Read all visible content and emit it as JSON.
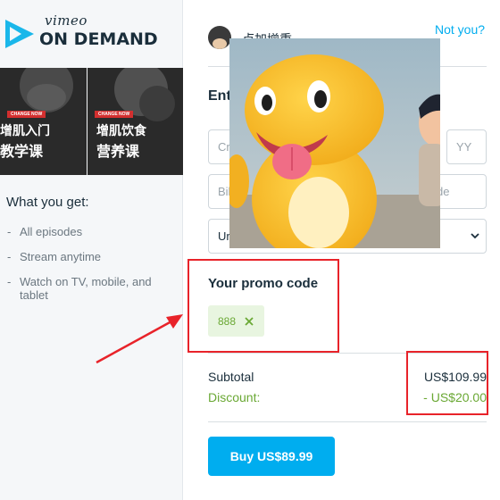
{
  "brand": {
    "logo_top": "vimeo",
    "logo_bottom": "ON DEMAND",
    "mark_color": "#1ab7ea"
  },
  "thumbnails": [
    {
      "badge": "CHANGE NOW",
      "title_line1": "增肌入门",
      "title_line2": "教学课"
    },
    {
      "badge": "CHANGE NOW",
      "title_line1": "增肌饮食",
      "title_line2": "营养课"
    }
  ],
  "sidebar": {
    "heading": "What you get:",
    "features": [
      "All episodes",
      "Stream anytime",
      "Watch on TV, mobile, and tablet"
    ]
  },
  "account": {
    "username": "卢加增重",
    "not_you_link": "Not you?"
  },
  "payment": {
    "section_title": "Ent",
    "card_placeholder": "Cr",
    "year_placeholder": "YY",
    "billing_placeholder": "Bil",
    "zip_placeholder": "de",
    "country_value": "Ur"
  },
  "promo": {
    "title": "Your promo code",
    "code": "888"
  },
  "summary": {
    "subtotal_label": "Subtotal",
    "subtotal_value": "US$109.99",
    "discount_label": "Discount:",
    "discount_value": "- US$20.00"
  },
  "buy_button": "Buy US$89.99",
  "colors": {
    "accent": "#00adef",
    "discount_green": "#6aa834",
    "annotation_red": "#e8232a"
  }
}
